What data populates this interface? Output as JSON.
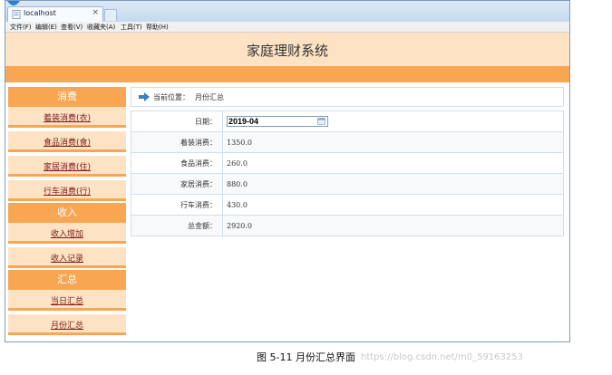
{
  "browser": {
    "tab_title": "localhost",
    "tab_close": "×",
    "menu": [
      "文件(F)",
      "编辑(E)",
      "查看(V)",
      "收藏夹(A)",
      "工具(T)",
      "帮助(H)"
    ]
  },
  "header": {
    "title": "家庭理财系统"
  },
  "sidebar": {
    "sections": [
      {
        "title": "消费",
        "items": [
          "着装消费(衣)",
          "食品消费(食)",
          "家居消费(住)",
          "行车消费(行)"
        ]
      },
      {
        "title": "收入",
        "items": [
          "收入增加",
          "收入记录"
        ]
      },
      {
        "title": "汇总",
        "items": [
          "当日汇总",
          "月份汇总"
        ]
      }
    ]
  },
  "breadcrumb": {
    "label": "当前位置：",
    "value": "月份汇总"
  },
  "form": {
    "date_label": "日期：",
    "date_value": "2019-04",
    "rows": [
      {
        "label": "着装消费：",
        "value": "1350.0"
      },
      {
        "label": "食品消费：",
        "value": "260.0"
      },
      {
        "label": "家居消费：",
        "value": "880.0"
      },
      {
        "label": "行车消费：",
        "value": "430.0"
      },
      {
        "label": "总金额：",
        "value": "2920.0"
      }
    ]
  },
  "caption": "图 5-11 月份汇总界面",
  "watermark": "https://blog.csdn.net/m0_59163253",
  "colors": {
    "accent_orange": "#f9a653",
    "light_orange": "#fde3c4",
    "link": "#7a1a1a"
  }
}
